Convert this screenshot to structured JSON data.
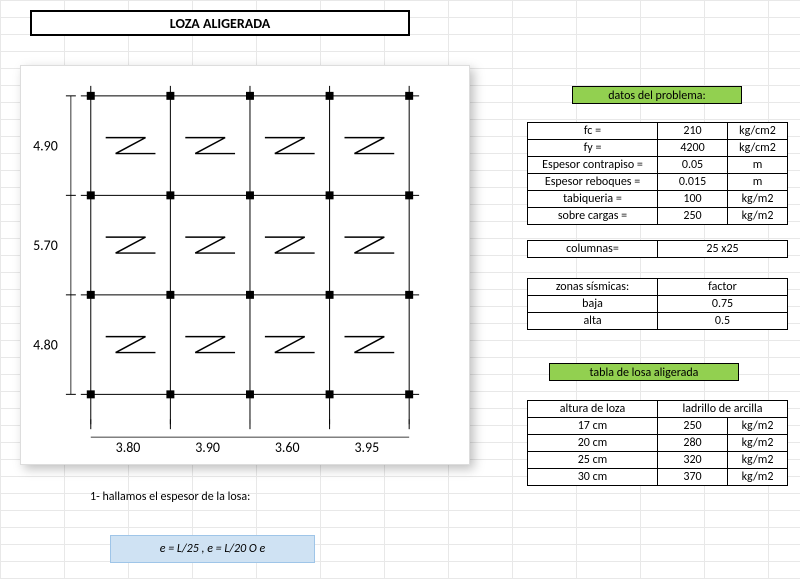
{
  "title": "LOZA ALIGERADA",
  "diagram": {
    "row_dims": [
      "4.90",
      "5.70",
      "4.80"
    ],
    "col_dims": [
      "3.80",
      "3.90",
      "3.60",
      "3.95"
    ]
  },
  "headers": {
    "datos": "datos del problema:",
    "tabla": "tabla de losa aligerada"
  },
  "datos": [
    {
      "label": "fc =",
      "value": "210",
      "unit": "kg/cm2"
    },
    {
      "label": "fy =",
      "value": "4200",
      "unit": "kg/cm2"
    },
    {
      "label": "Espesor contrapiso =",
      "value": "0.05",
      "unit": "m"
    },
    {
      "label": "Espesor reboques =",
      "value": "0.015",
      "unit": "m"
    },
    {
      "label": "tabiqueria =",
      "value": "100",
      "unit": "kg/m2"
    },
    {
      "label": "sobre cargas =",
      "value": "250",
      "unit": "kg/m2"
    }
  ],
  "columnas": {
    "label": "columnas=",
    "value": "25 x25"
  },
  "sismica": {
    "h1": "zonas sísmicas:",
    "h2": "factor",
    "rows": [
      {
        "zone": "baja",
        "factor": "0.75"
      },
      {
        "zone": "alta",
        "factor": "0.5"
      }
    ]
  },
  "losa": {
    "h1": "altura de loza",
    "h2": "ladrillo de arcilla",
    "rows": [
      {
        "h": "17 cm",
        "v": "250",
        "u": "kg/m2"
      },
      {
        "h": "20 cm",
        "v": "280",
        "u": "kg/m2"
      },
      {
        "h": "25 cm",
        "v": "320",
        "u": "kg/m2"
      },
      {
        "h": "30 cm",
        "v": "370",
        "u": "kg/m2"
      }
    ]
  },
  "footnote": "1- hallamos el espesor de la losa:",
  "formula": "e = L/25 , e = L/20  O e"
}
